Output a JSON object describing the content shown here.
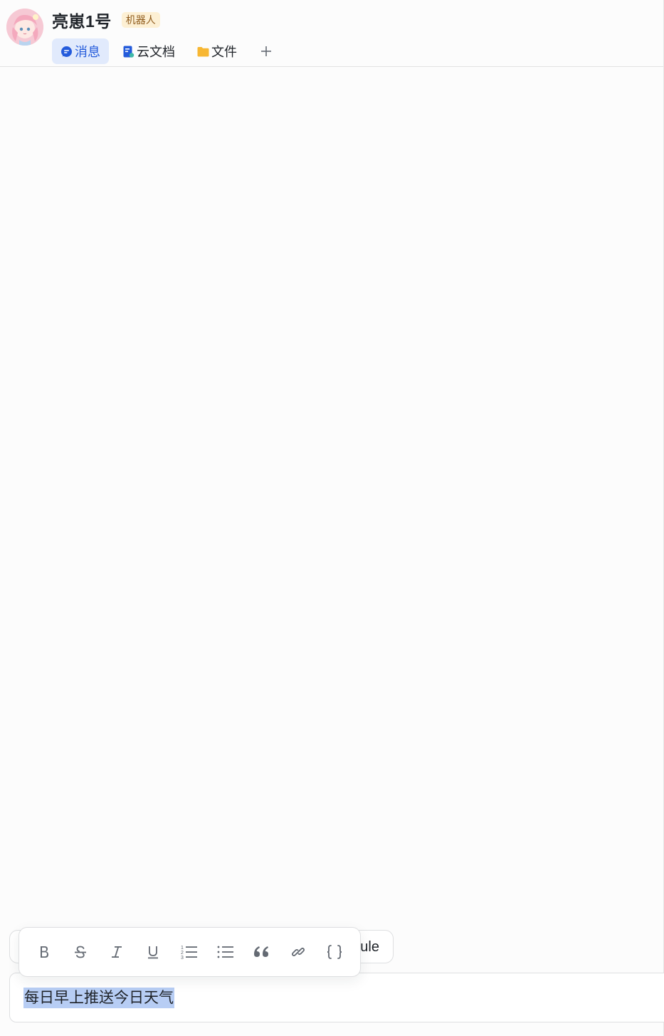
{
  "header": {
    "title": "亮崽1号",
    "badge": "机器人"
  },
  "tabs": [
    {
      "label": "消息",
      "icon": "chat-bubble-icon",
      "active": true
    },
    {
      "label": "云文档",
      "icon": "document-icon",
      "active": false
    },
    {
      "label": "文件",
      "icon": "folder-icon",
      "active": false
    }
  ],
  "add_tab_icon": "plus-icon",
  "chip_behind": {
    "visible_text": "ule"
  },
  "input": {
    "value": "每日早上推送今日天气"
  },
  "format_toolbar": {
    "buttons": [
      "bold-icon",
      "strikethrough-icon",
      "italic-icon",
      "underline-icon",
      "ordered-list-icon",
      "bullet-list-icon",
      "quote-icon",
      "link-icon",
      "code-block-icon"
    ]
  },
  "colors": {
    "accent": "#245bdb",
    "active_tab_bg": "#e1eafc",
    "badge_bg": "#fdf0d4",
    "badge_text": "#8f5b1c",
    "selection": "#b7cdf4",
    "folder": "#f7b733"
  }
}
